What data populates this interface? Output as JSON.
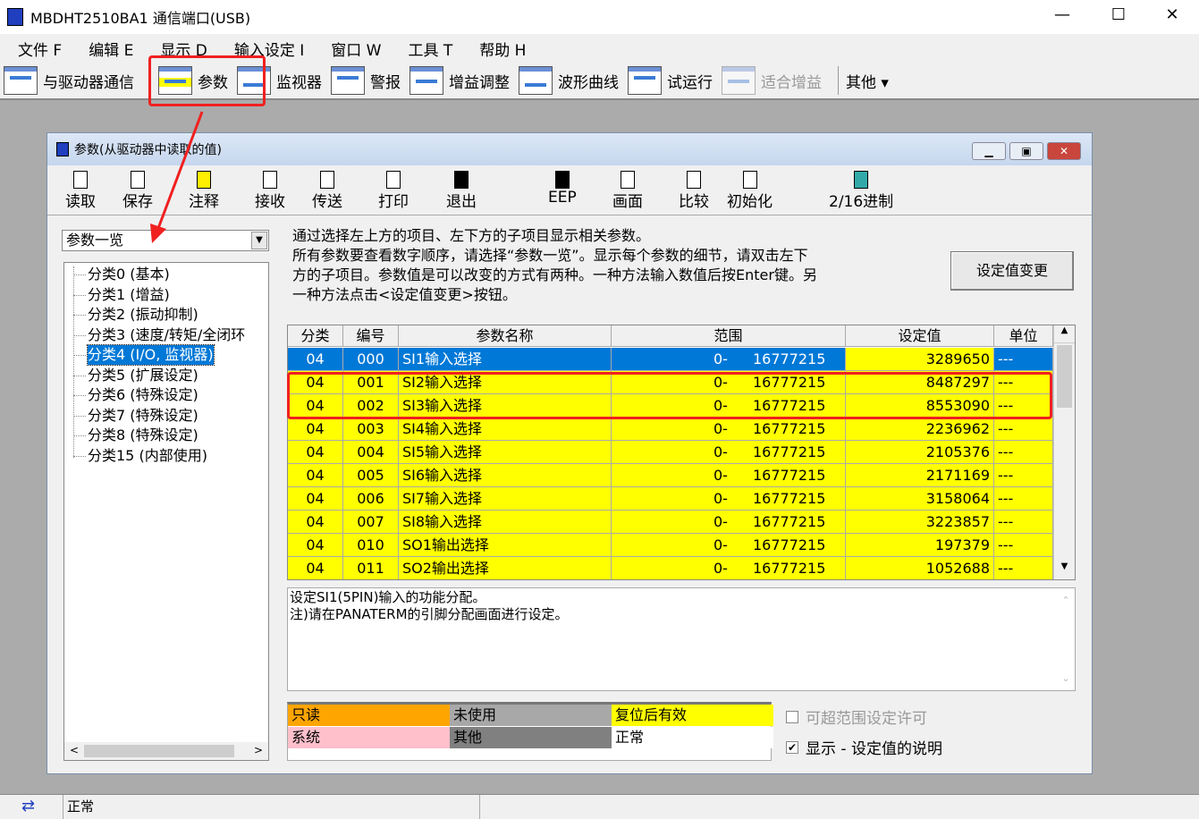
{
  "window": {
    "title": "MBDHT2510BA1  通信端口(USB)",
    "min": "—",
    "max": "☐",
    "close": "✕"
  },
  "menu": [
    "文件 F",
    "编辑 E",
    "显示 D",
    "输入设定 I",
    "窗口 W",
    "工具 T",
    "帮助 H"
  ],
  "toolbar": [
    {
      "label": "与驱动器通信"
    },
    {
      "label": "参数"
    },
    {
      "label": "监视器"
    },
    {
      "label": "警报"
    },
    {
      "label": "增益调整"
    },
    {
      "label": "波形曲线"
    },
    {
      "label": "试运行"
    },
    {
      "label": "适合增益",
      "disabled": true
    },
    {
      "label": "其他 ▾"
    }
  ],
  "child": {
    "title": "参数(从驱动器中读取的值)",
    "tools": [
      "读取",
      "保存",
      "注释",
      "接收",
      "传送",
      "打印",
      "退出",
      "EEP",
      "画面",
      "比较",
      "初始化",
      "2/16进制"
    ],
    "combo": "参数一览",
    "tree": [
      "分类0 (基本)",
      "分类1 (增益)",
      "分类2 (振动抑制)",
      "分类3 (速度/转矩/全闭环",
      "分类4 (I/O, 监视器)",
      "分类5 (扩展设定)",
      "分类6 (特殊设定)",
      "分类7 (特殊设定)",
      "分类8 (特殊设定)",
      "分类15 (内部使用)"
    ],
    "tree_selected": 4,
    "description": [
      "通过选择左上方的项目、左下方的子项目显示相关参数。",
      "所有参数要查看数字顺序，请选择“参数一览”。显示每个参数的细节，请双击左下",
      "方的子项目。参数值是可以改变的方式有两种。一种方法输入数值后按Enter键。另",
      "一种方法点击<设定值变更>按钮。"
    ],
    "change_button": "设定值变更",
    "table": {
      "headers": [
        "分类",
        "编号",
        "参数名称",
        "范围",
        "设定值",
        "单位"
      ],
      "rows": [
        [
          "04",
          "000",
          "SI1输入选择",
          "0-",
          "16777215",
          "3289650",
          "---"
        ],
        [
          "04",
          "001",
          "SI2输入选择",
          "0-",
          "16777215",
          "8487297",
          "---"
        ],
        [
          "04",
          "002",
          "SI3输入选择",
          "0-",
          "16777215",
          "8553090",
          "---"
        ],
        [
          "04",
          "003",
          "SI4输入选择",
          "0-",
          "16777215",
          "2236962",
          "---"
        ],
        [
          "04",
          "004",
          "SI5输入选择",
          "0-",
          "16777215",
          "2105376",
          "---"
        ],
        [
          "04",
          "005",
          "SI6输入选择",
          "0-",
          "16777215",
          "2171169",
          "---"
        ],
        [
          "04",
          "006",
          "SI7输入选择",
          "0-",
          "16777215",
          "3158064",
          "---"
        ],
        [
          "04",
          "007",
          "SI8输入选择",
          "0-",
          "16777215",
          "3223857",
          "---"
        ],
        [
          "04",
          "010",
          "SO1输出选择",
          "0-",
          "16777215",
          "197379",
          "---"
        ],
        [
          "04",
          "011",
          "SO2输出选择",
          "0-",
          "16777215",
          "1052688",
          "---"
        ]
      ],
      "selected_row": 0
    },
    "detail": [
      "设定SI1(5PIN)输入的功能分配。",
      "注)请在PANATERM的引脚分配画面进行设定。"
    ],
    "legend": [
      {
        "label": "只读",
        "color": "#ffa500"
      },
      {
        "label": "未使用",
        "color": "#a8a8a8"
      },
      {
        "label": "复位后有效",
        "color": "#ffff00"
      },
      {
        "label": "系统",
        "color": "#ffc0cb"
      },
      {
        "label": "其他",
        "color": "#808080"
      },
      {
        "label": "正常",
        "color": "#ffffff"
      }
    ],
    "allow_out_of_range": {
      "label": "可超范围设定许可",
      "checked": false,
      "disabled": true
    },
    "show_description": {
      "label": "显示 - 设定值的说明",
      "checked": true
    }
  },
  "status": {
    "text": "正常"
  }
}
